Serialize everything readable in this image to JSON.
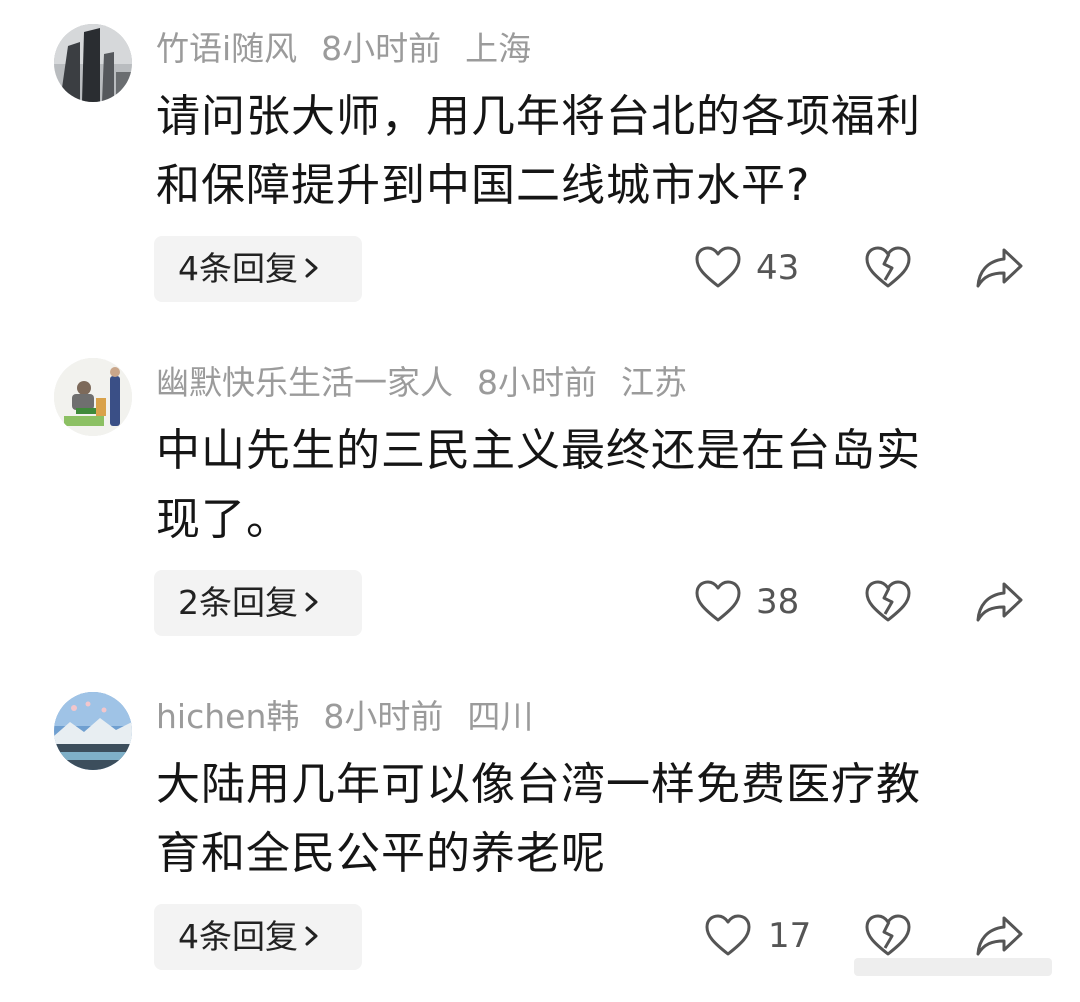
{
  "comments": [
    {
      "username": "竹语i随风",
      "time": "8小时前",
      "location": "上海",
      "text_line1": "请问张大师，用几年将台北的各项福利",
      "text_line2": "和保障提升到中国二线城市水平?",
      "replies_label": "4条回复",
      "likes": "43"
    },
    {
      "username": "幽默快乐生活一家人",
      "time": "8小时前",
      "location": "江苏",
      "text_line1": "中山先生的三民主义最终还是在台岛实",
      "text_line2": "现了。",
      "replies_label": "2条回复",
      "likes": "38"
    },
    {
      "username": "hichen韩",
      "time": "8小时前",
      "location": "四川",
      "text_line1": "大陆用几年可以像台湾一样免费医疗教",
      "text_line2": "育和全民公平的养老呢",
      "replies_label": "4条回复",
      "likes": "17"
    }
  ],
  "icons": {
    "like": "heart-outline-icon",
    "dislike": "broken-heart-icon",
    "share": "share-arrow-icon",
    "reply_chevron": "chevron-right-icon"
  },
  "colors": {
    "meta_text": "#9b9b9b",
    "body_text": "#151515",
    "reply_bg": "#f3f3f3",
    "icon_stroke": "#555555"
  }
}
